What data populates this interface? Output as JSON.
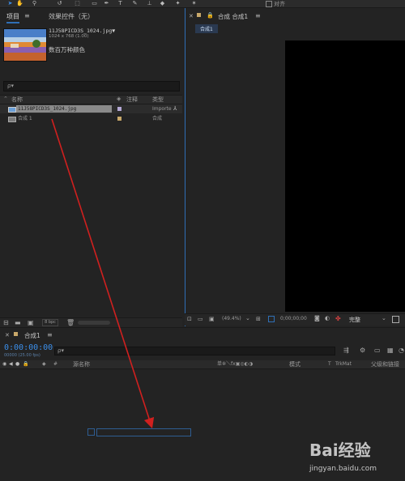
{
  "accent_colors": {
    "selection_blue": "#2f6fb6",
    "timecode_blue": "#3b8eea",
    "annotation_red": "#d0201f"
  },
  "toolbar": {
    "align_label": "对齐",
    "icons": [
      "select-icon",
      "hand-icon",
      "zoom-icon",
      "camera-icon",
      "pan-icon",
      "rect-icon",
      "pen-icon",
      "text-icon",
      "brush-icon",
      "stamp-icon",
      "eraser-icon",
      "roto-icon",
      "pin-icon"
    ]
  },
  "project_panel": {
    "tab_project": "项目",
    "tab_effects": "效果控件（无）",
    "preview": {
      "filename": "11J58PICD3S_1024.jpg▼",
      "dimensions": "1024 x 768 (1.00)",
      "note": "数百万种颜色"
    },
    "search_placeholder": "ρ▾",
    "columns": {
      "name": "名称",
      "comment": "注释",
      "type": "类型"
    },
    "rows": [
      {
        "name": "11J58PICD3S_1024.jpg",
        "type": "Importe",
        "swatch": "#b5a9d6"
      },
      {
        "name": "合成 1",
        "type": "合成",
        "swatch": "#c8a86a"
      }
    ],
    "bpc_label": "8 bpc"
  },
  "comp_panel": {
    "tab_title": "合成 合成1",
    "sub_tab": "合成1",
    "zoom": "(49.4%)",
    "timecode": "0;00;00;00",
    "quality": "完整"
  },
  "timeline": {
    "tab_title": "合成1",
    "timecode": "0:00:00:00",
    "frame_info": "00000 (25.00 fps)",
    "search_placeholder": "ρ▾",
    "columns": {
      "hash": "#",
      "source_name": "源名称",
      "switches": "单✲＼fx▣◎◐◑",
      "mode": "模式",
      "t": "T",
      "trkmat": "TrkMat",
      "parent": "父级和链接"
    }
  },
  "watermark": {
    "brand": "Bai经验",
    "url": "jingyan.baidu.com"
  }
}
